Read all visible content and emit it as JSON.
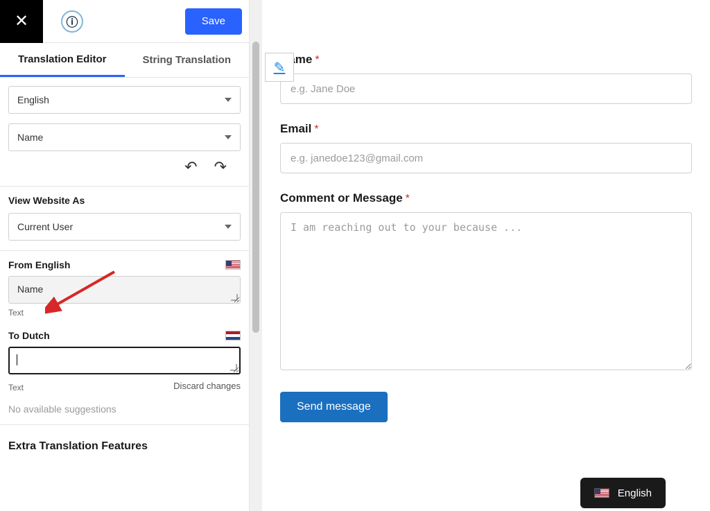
{
  "topbar": {
    "info_glyph": "ⓘ",
    "close_glyph": "✕",
    "save_label": "Save"
  },
  "tabs": {
    "editor": "Translation Editor",
    "string": "String Translation"
  },
  "selects": {
    "language": "English",
    "element": "Name"
  },
  "history": {
    "undo_glyph": "↶",
    "redo_glyph": "↷"
  },
  "view_as": {
    "label": "View Website As",
    "value": "Current User"
  },
  "from": {
    "label": "From English",
    "value": "Name",
    "caption": "Text"
  },
  "to": {
    "label": "To Dutch",
    "value": "",
    "caption": "Text",
    "discard": "Discard changes"
  },
  "suggestions": {
    "none": "No available suggestions"
  },
  "features": {
    "heading": "Extra Translation Features"
  },
  "form": {
    "name": {
      "label": "Name",
      "placeholder": "e.g. Jane Doe"
    },
    "email": {
      "label": "Email",
      "placeholder": "e.g. janedoe123@gmail.com"
    },
    "message": {
      "label": "Comment or Message",
      "placeholder": "I am reaching out to your because ..."
    },
    "submit": "Send message"
  },
  "lang_switcher": {
    "label": "English"
  },
  "edit_badge": {
    "glyph": "✎"
  },
  "colors": {
    "accent": "#2962ff",
    "primary_button": "#1a6fbf",
    "required": "#d62828"
  }
}
